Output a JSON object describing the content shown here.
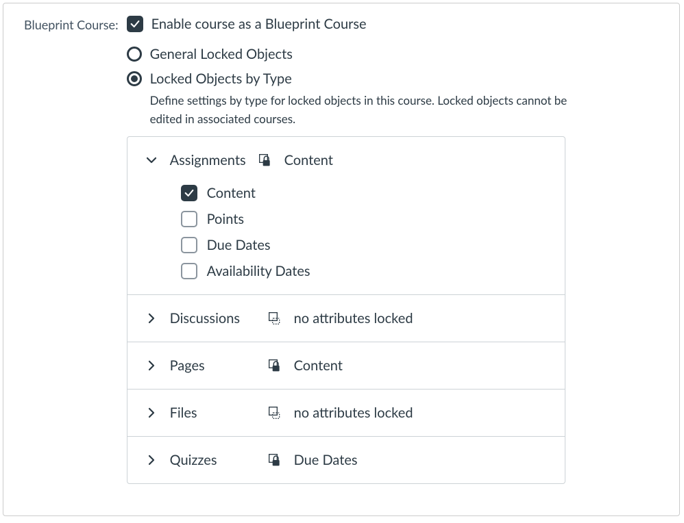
{
  "label": "Blueprint Course:",
  "enable_label": "Enable course as a Blueprint Course",
  "enable_checked": true,
  "radio_general": "General Locked Objects",
  "radio_by_type": "Locked Objects by Type",
  "radio_selected": "by_type",
  "description": "Define settings by type for locked objects in this course. Locked objects cannot be edited in associated courses.",
  "types": [
    {
      "name": "Assignments",
      "locked": true,
      "status": "Content",
      "expanded": true,
      "options": [
        {
          "label": "Content",
          "checked": true
        },
        {
          "label": "Points",
          "checked": false
        },
        {
          "label": "Due Dates",
          "checked": false
        },
        {
          "label": "Availability Dates",
          "checked": false
        }
      ]
    },
    {
      "name": "Discussions",
      "locked": false,
      "status": "no attributes locked",
      "expanded": false
    },
    {
      "name": "Pages",
      "locked": true,
      "status": "Content",
      "expanded": false
    },
    {
      "name": "Files",
      "locked": false,
      "status": "no attributes locked",
      "expanded": false
    },
    {
      "name": "Quizzes",
      "locked": true,
      "status": "Due Dates",
      "expanded": false
    }
  ]
}
